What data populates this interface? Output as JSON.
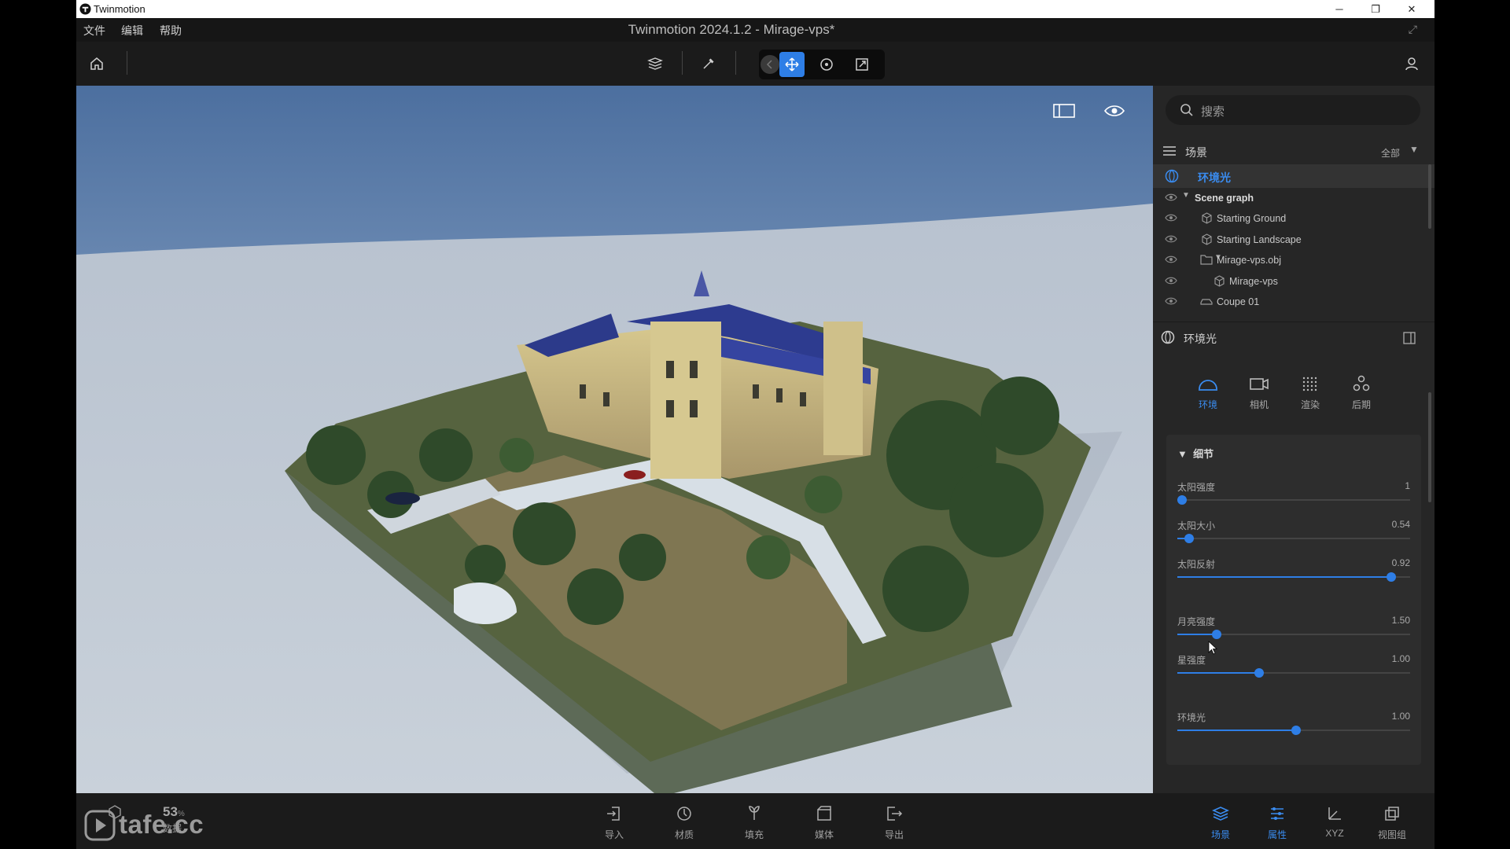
{
  "os_window": {
    "app_name": "Twinmotion"
  },
  "menu": {
    "items": [
      "文件",
      "编辑",
      "帮助"
    ],
    "document_title": "Twinmotion 2024.1.2 - Mirage-vps*"
  },
  "colors": {
    "accent": "#3a8cf0",
    "panel": "#262626",
    "viewport_sky": "#7f9cc0"
  },
  "toolbar": {
    "icons": [
      "home-icon",
      "layers-icon",
      "pick-icon",
      "back-icon",
      "move-icon",
      "rotate-icon",
      "scale-icon",
      "user-icon"
    ],
    "active_tool": "move"
  },
  "viewport": {
    "icons": [
      "panel-toggle-icon",
      "eye-icon"
    ]
  },
  "search": {
    "placeholder": "搜索"
  },
  "scene": {
    "title": "场景",
    "filter_label": "全部",
    "ambient_label": "环境光",
    "tree": [
      {
        "label": "Scene graph",
        "icon": "triangle-down-icon"
      },
      {
        "label": "Starting Ground",
        "icon": "object-icon"
      },
      {
        "label": "Starting Landscape",
        "icon": "object-icon"
      },
      {
        "label": "Mirage-vps.obj",
        "icon": "folder-icon"
      },
      {
        "label": "Mirage-vps",
        "icon": "object-icon"
      },
      {
        "label": "Coupe 01",
        "icon": "car-icon"
      }
    ]
  },
  "properties": {
    "title": "环境光",
    "tabs": [
      {
        "label": "环境",
        "icon": "environment-icon",
        "active": true
      },
      {
        "label": "相机",
        "icon": "camera-icon",
        "active": false
      },
      {
        "label": "渲染",
        "icon": "render-icon",
        "active": false
      },
      {
        "label": "后期",
        "icon": "post-icon",
        "active": false
      }
    ],
    "details_title": "细节",
    "sliders": [
      {
        "label": "太阳强度",
        "value": "1",
        "fraction": 0.02
      },
      {
        "label": "太阳大小",
        "value": "0.54",
        "fraction": 0.05
      },
      {
        "label": "太阳反射",
        "value": "0.92",
        "fraction": 0.92
      },
      {
        "label": "月亮强度",
        "value": "1.50",
        "fraction": 0.17
      },
      {
        "label": "星强度",
        "value": "1.00",
        "fraction": 0.35
      },
      {
        "label": "环境光",
        "value": "1.00",
        "fraction": 0.51
      }
    ]
  },
  "bottombar": {
    "stats": {
      "value": "53",
      "unit": "%",
      "label": "数据"
    },
    "center_items": [
      {
        "label": "导入",
        "icon": "import-icon"
      },
      {
        "label": "材质",
        "icon": "material-icon"
      },
      {
        "label": "填充",
        "icon": "populate-icon"
      },
      {
        "label": "媒体",
        "icon": "media-icon"
      },
      {
        "label": "导出",
        "icon": "export-icon"
      }
    ],
    "right_items": [
      {
        "label": "场景",
        "icon": "scene-layers-icon",
        "active": true
      },
      {
        "label": "属性",
        "icon": "properties-icon",
        "active": true
      },
      {
        "label": "XYZ",
        "icon": "xyz-icon",
        "active": false
      },
      {
        "label": "视图组",
        "icon": "viewset-icon",
        "active": false
      }
    ]
  },
  "watermark": {
    "text": "tafe.cc"
  }
}
